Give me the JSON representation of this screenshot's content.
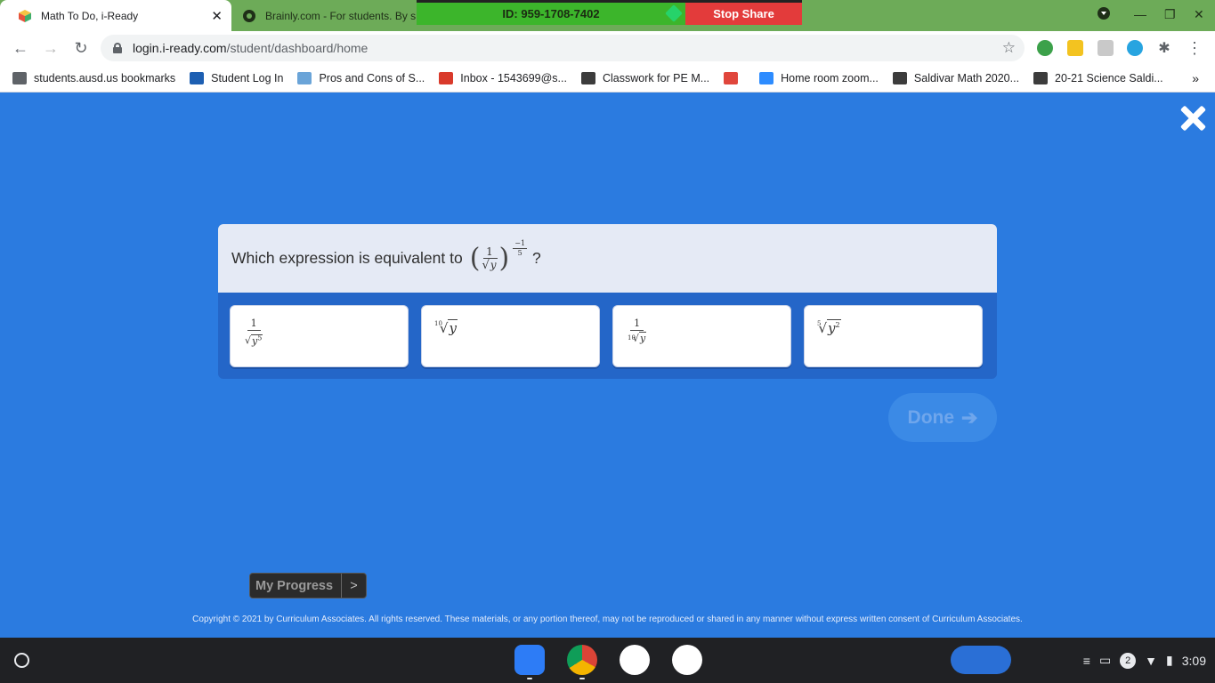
{
  "browser": {
    "tabs": [
      {
        "title": "Math To Do, i-Ready",
        "active": true
      },
      {
        "title": "Brainly.com - For students. By s",
        "active": false
      }
    ],
    "share_bar": {
      "id_text": "ID: 959-1708-7402",
      "stop_label": "Stop Share"
    },
    "url": {
      "host": "login.i-ready.com",
      "path": "/student/dashboard/home"
    },
    "bookmarks": [
      "students.ausd.us bookmarks",
      "Student Log In",
      "Pros and Cons of S...",
      "Inbox - 1543699@s...",
      "Classwork for PE M...",
      "",
      "Home room zoom...",
      "Saldivar Math 2020...",
      "20-21 Science Saldi..."
    ],
    "bookmarks_more": "»"
  },
  "question": {
    "prompt": "Which expression is equivalent to",
    "expr": {
      "num": "1",
      "radicand": "y",
      "exp_num": "−1",
      "exp_den": "5"
    },
    "end_mark": "?"
  },
  "choices": [
    {
      "type": "fraction",
      "num": "1",
      "radicand": "y",
      "power": "5"
    },
    {
      "type": "root",
      "index": "10",
      "radicand": "y"
    },
    {
      "type": "fraction-root",
      "num": "1",
      "index": "10",
      "radicand": "y"
    },
    {
      "type": "root-power",
      "index": "5",
      "radicand": "y",
      "power": "2"
    }
  ],
  "buttons": {
    "done": "Done",
    "done_arrow": "➔",
    "progress": "My Progress",
    "progress_arrow": ">"
  },
  "footer": {
    "copyright": "Copyright © 2021 by Curriculum Associates. All rights reserved. These materials, or any portion thereof, may not be reproduced or shared in any manner without express written consent of Curriculum Associates."
  },
  "shelf": {
    "notification_count": "2",
    "time": "3:09"
  },
  "colors": {
    "background": "#2b7be0",
    "tab_strip": "#6dab58",
    "question_panel": "#e5eaf5"
  }
}
